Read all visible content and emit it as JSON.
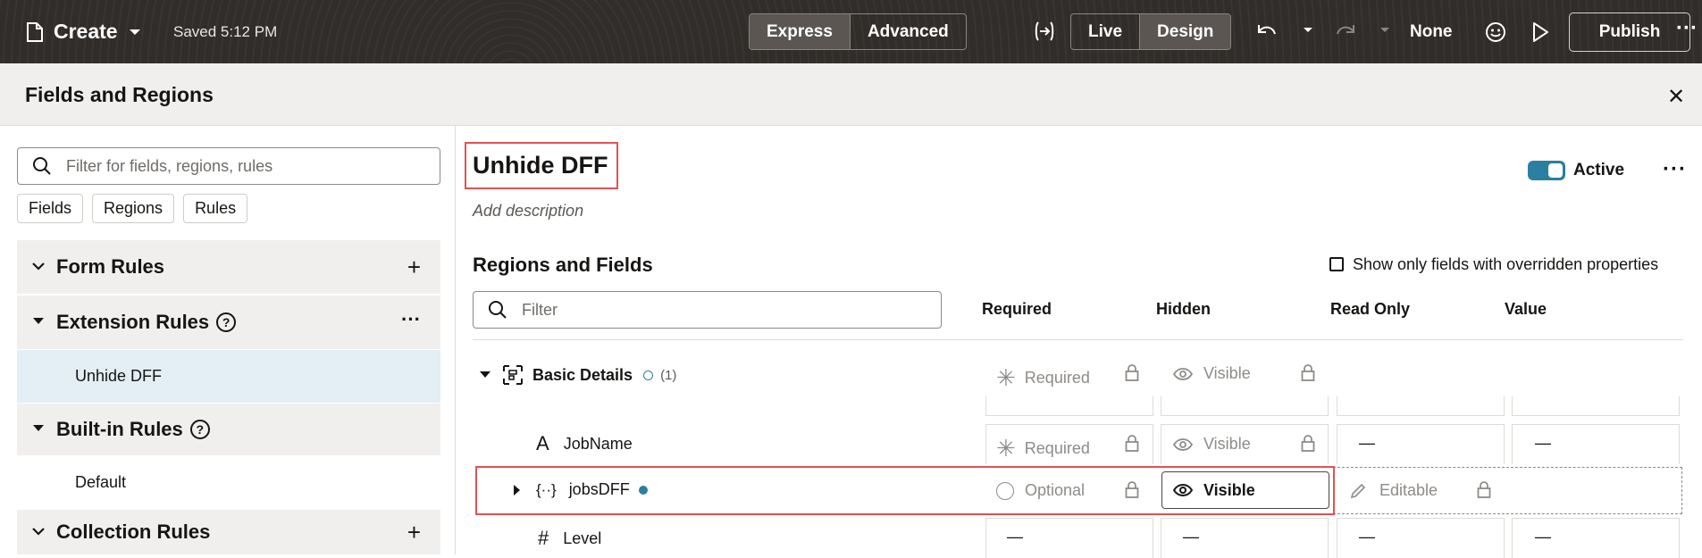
{
  "topbar": {
    "create_label": "Create",
    "saved_label": "Saved 5:12 PM",
    "mode_express": "Express",
    "mode_advanced": "Advanced",
    "view_live": "Live",
    "view_design": "Design",
    "context_label": "None",
    "publish_label": "Publish",
    "icons": [
      "page-icon",
      "chevron-down-icon",
      "code-arrow-icon",
      "undo-icon",
      "redo-icon",
      "smiley-icon",
      "play-icon",
      "more-icon"
    ]
  },
  "drawer": {
    "title": "Fields and Regions"
  },
  "left": {
    "filter_placeholder": "Filter for fields, regions, rules",
    "chips": [
      "Fields",
      "Regions",
      "Rules"
    ],
    "form_rules": "Form Rules",
    "extension_rules": "Extension Rules",
    "extension_rule_item": "Unhide DFF",
    "builtin_rules": "Built-in Rules",
    "builtin_item": "Default",
    "collection_rules": "Collection Rules"
  },
  "rule": {
    "title": "Unhide DFF",
    "description_placeholder": "Add description",
    "active_label": "Active",
    "active": true
  },
  "regions": {
    "title": "Regions and Fields",
    "checkbox_label": "Show only fields with overridden properties",
    "filter_placeholder": "Filter",
    "columns": [
      "Required",
      "Hidden",
      "Read Only",
      "Value"
    ],
    "group": {
      "name": "Basic Details",
      "count": "(1)",
      "required": "Required",
      "hidden": "Visible"
    },
    "rows": [
      {
        "name": "JobName",
        "required": "Required",
        "hidden": "Visible",
        "readonly": "—",
        "value": "—"
      },
      {
        "name": "jobsDFF",
        "required": "Optional",
        "hidden": "Visible",
        "readonly": "Editable",
        "value": ""
      },
      {
        "name": "Level",
        "required": "—",
        "hidden": "—",
        "readonly": "—",
        "value": "—"
      }
    ]
  },
  "colors": {
    "accent": "#2b7fa1",
    "highlight": "#e05254",
    "topbar": "#312d2a"
  }
}
